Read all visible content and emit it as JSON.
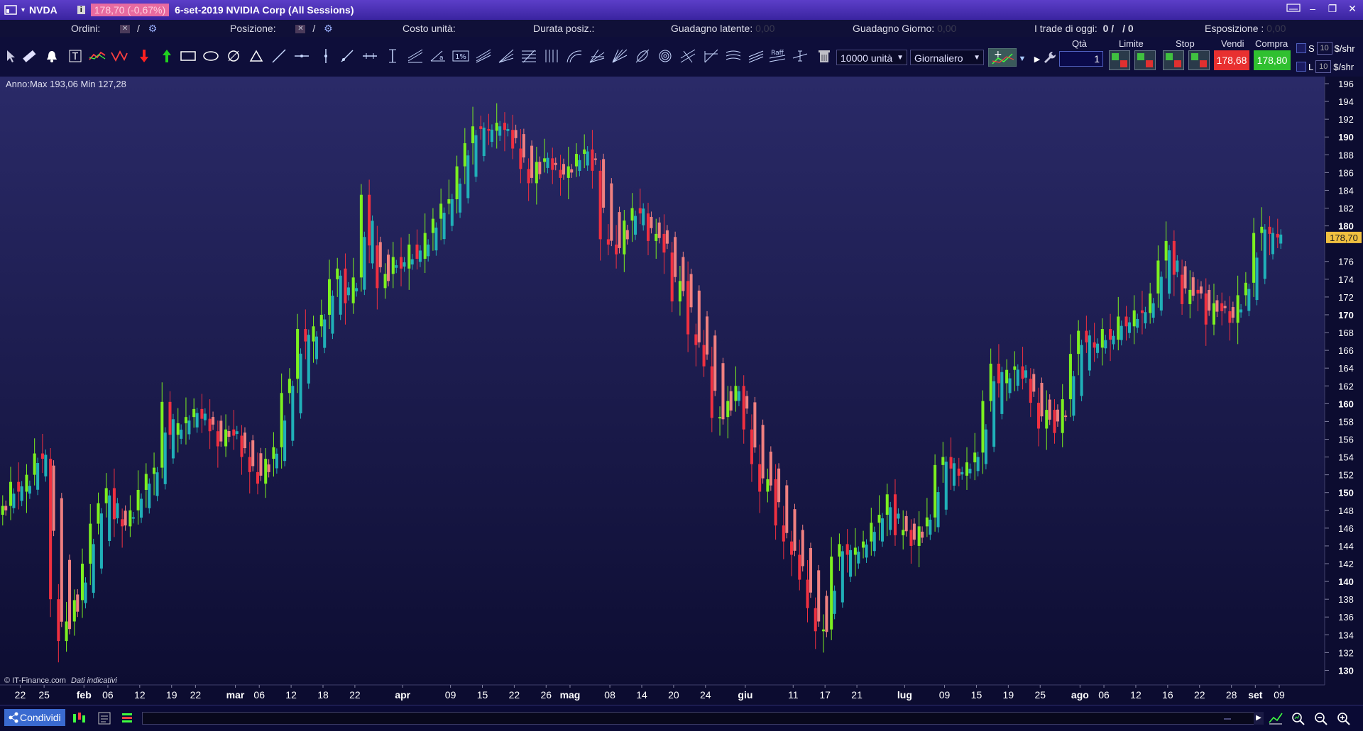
{
  "app": {
    "symbol": "NVDA",
    "info_badge": "i",
    "price_box": "178,70 (-0,67%)",
    "title": "6-set-2019 NVIDIA Corp (All Sessions)"
  },
  "status": {
    "orders_label": "Ordini:",
    "orders_sep": "/",
    "position_label": "Posizione:",
    "position_sep": "/",
    "unit_cost_label": "Costo unità:",
    "duration_label": "Durata posiz.:",
    "unrealized_label": "Guadagno latente:",
    "unrealized_value": "0,00",
    "day_gain_label": "Guadagno Giorno:",
    "day_gain_value": "0,00",
    "trades_label": "I trade di oggi:",
    "trades_value": "0 /",
    "trades_value2": "/ 0",
    "exposure_label": "Esposizione :",
    "exposure_value": "0,00"
  },
  "toolbar": {
    "quantity_select": "10000 unità",
    "period_select": "Giornaliero",
    "raff_label": "Raff",
    "order_labels": {
      "qty": "Qtà",
      "limit": "Limite",
      "stop": "Stop",
      "sell": "Vendi",
      "buy": "Compra"
    },
    "qty_value": "1",
    "sell_price": "178,68",
    "buy_price": "178,80",
    "s_label": "S",
    "l_label": "L",
    "s_num": "10",
    "l_num": "10",
    "per_share": "$/shr"
  },
  "chart_header": "Anno:Max 193,06 Min 127,28",
  "watermark_brand": "© IT-Finance.com",
  "watermark_note": "Dati indicativi",
  "bottom": {
    "share_label": "Condividi"
  },
  "colors": {
    "bg_top": "#2a2a6a",
    "bg_bottom": "#0c0c30",
    "up": "#7cf020",
    "down": "#f03040",
    "trend_up": "#20b0b8",
    "trend_down": "#f08080",
    "price_tag": "#f0c040"
  },
  "chart_data": {
    "type": "candlestick",
    "series_name": "NVDA",
    "ylim": [
      129,
      196
    ],
    "last_price": "178,70",
    "y_ticks": [
      {
        "v": 196,
        "label": "196",
        "bold": false
      },
      {
        "v": 194,
        "label": "194",
        "bold": false
      },
      {
        "v": 192,
        "label": "192",
        "bold": false
      },
      {
        "v": 190,
        "label": "190",
        "bold": true
      },
      {
        "v": 188,
        "label": "188",
        "bold": false
      },
      {
        "v": 186,
        "label": "186",
        "bold": false
      },
      {
        "v": 184,
        "label": "184",
        "bold": false
      },
      {
        "v": 182,
        "label": "182",
        "bold": false
      },
      {
        "v": 180,
        "label": "180",
        "bold": true
      },
      {
        "v": 176,
        "label": "176",
        "bold": false
      },
      {
        "v": 174,
        "label": "174",
        "bold": false
      },
      {
        "v": 172,
        "label": "172",
        "bold": false
      },
      {
        "v": 170,
        "label": "170",
        "bold": true
      },
      {
        "v": 168,
        "label": "168",
        "bold": false
      },
      {
        "v": 166,
        "label": "166",
        "bold": false
      },
      {
        "v": 164,
        "label": "164",
        "bold": false
      },
      {
        "v": 162,
        "label": "162",
        "bold": false
      },
      {
        "v": 160,
        "label": "160",
        "bold": true
      },
      {
        "v": 158,
        "label": "158",
        "bold": false
      },
      {
        "v": 156,
        "label": "156",
        "bold": false
      },
      {
        "v": 154,
        "label": "154",
        "bold": false
      },
      {
        "v": 152,
        "label": "152",
        "bold": false
      },
      {
        "v": 150,
        "label": "150",
        "bold": true
      },
      {
        "v": 148,
        "label": "148",
        "bold": false
      },
      {
        "v": 146,
        "label": "146",
        "bold": false
      },
      {
        "v": 144,
        "label": "144",
        "bold": false
      },
      {
        "v": 142,
        "label": "142",
        "bold": false
      },
      {
        "v": 140,
        "label": "140",
        "bold": true
      },
      {
        "v": 138,
        "label": "138",
        "bold": false
      },
      {
        "v": 136,
        "label": "136",
        "bold": false
      },
      {
        "v": 134,
        "label": "134",
        "bold": false
      },
      {
        "v": 132,
        "label": "132",
        "bold": false
      },
      {
        "v": 130,
        "label": "130",
        "bold": true
      }
    ],
    "x_ticks": [
      {
        "label": "22",
        "bold": false,
        "x": "2019-01-22"
      },
      {
        "label": "25",
        "bold": false,
        "x": "2019-01-25"
      },
      {
        "label": "feb",
        "bold": true,
        "x": "2019-02-01"
      },
      {
        "label": "06",
        "bold": false,
        "x": "2019-02-06"
      },
      {
        "label": "12",
        "bold": false,
        "x": "2019-02-12"
      },
      {
        "label": "19",
        "bold": false,
        "x": "2019-02-19"
      },
      {
        "label": "22",
        "bold": false,
        "x": "2019-02-22"
      },
      {
        "label": "mar",
        "bold": true,
        "x": "2019-03-01"
      },
      {
        "label": "06",
        "bold": false,
        "x": "2019-03-06"
      },
      {
        "label": "12",
        "bold": false,
        "x": "2019-03-12"
      },
      {
        "label": "18",
        "bold": false,
        "x": "2019-03-18"
      },
      {
        "label": "22",
        "bold": false,
        "x": "2019-03-22"
      },
      {
        "label": "apr",
        "bold": true,
        "x": "2019-04-01"
      },
      {
        "label": "09",
        "bold": false,
        "x": "2019-04-09"
      },
      {
        "label": "15",
        "bold": false,
        "x": "2019-04-15"
      },
      {
        "label": "22",
        "bold": false,
        "x": "2019-04-22"
      },
      {
        "label": "26",
        "bold": false,
        "x": "2019-04-26"
      },
      {
        "label": "mag",
        "bold": true,
        "x": "2019-05-01"
      },
      {
        "label": "08",
        "bold": false,
        "x": "2019-05-08"
      },
      {
        "label": "14",
        "bold": false,
        "x": "2019-05-14"
      },
      {
        "label": "20",
        "bold": false,
        "x": "2019-05-20"
      },
      {
        "label": "24",
        "bold": false,
        "x": "2019-05-24"
      },
      {
        "label": "giu",
        "bold": true,
        "x": "2019-06-03"
      },
      {
        "label": "11",
        "bold": false,
        "x": "2019-06-11"
      },
      {
        "label": "17",
        "bold": false,
        "x": "2019-06-17"
      },
      {
        "label": "21",
        "bold": false,
        "x": "2019-06-21"
      },
      {
        "label": "lug",
        "bold": true,
        "x": "2019-07-01"
      },
      {
        "label": "09",
        "bold": false,
        "x": "2019-07-09"
      },
      {
        "label": "15",
        "bold": false,
        "x": "2019-07-15"
      },
      {
        "label": "19",
        "bold": false,
        "x": "2019-07-19"
      },
      {
        "label": "25",
        "bold": false,
        "x": "2019-07-25"
      },
      {
        "label": "ago",
        "bold": true,
        "x": "2019-08-01"
      },
      {
        "label": "06",
        "bold": false,
        "x": "2019-08-06"
      },
      {
        "label": "12",
        "bold": false,
        "x": "2019-08-12"
      },
      {
        "label": "16",
        "bold": false,
        "x": "2019-08-16"
      },
      {
        "label": "22",
        "bold": false,
        "x": "2019-08-22"
      },
      {
        "label": "28",
        "bold": false,
        "x": "2019-08-28"
      },
      {
        "label": "set",
        "bold": true,
        "x": "2019-09-03"
      },
      {
        "label": "09",
        "bold": false,
        "x": "2019-09-09"
      }
    ],
    "candles": [
      {
        "x": "2019-01-18",
        "c": 148.5
      },
      {
        "x": "2019-01-21",
        "c": 151.2
      },
      {
        "x": "2019-01-22",
        "c": 150.1
      },
      {
        "x": "2019-01-23",
        "c": 152.0
      },
      {
        "x": "2019-01-24",
        "c": 154.4
      },
      {
        "x": "2019-01-25",
        "c": 153.8
      },
      {
        "x": "2019-01-28",
        "c": 138.0
      },
      {
        "x": "2019-01-29",
        "c": 133.3
      },
      {
        "x": "2019-01-30",
        "c": 135.5
      },
      {
        "x": "2019-01-31",
        "c": 137.9
      },
      {
        "x": "2019-02-01",
        "c": 142.0
      },
      {
        "x": "2019-02-04",
        "c": 146.5
      },
      {
        "x": "2019-02-05",
        "c": 148.8
      },
      {
        "x": "2019-02-06",
        "c": 150.5
      },
      {
        "x": "2019-02-07",
        "c": 147.0
      },
      {
        "x": "2019-02-08",
        "c": 146.2
      },
      {
        "x": "2019-02-11",
        "c": 148.0
      },
      {
        "x": "2019-02-12",
        "c": 150.3
      },
      {
        "x": "2019-02-13",
        "c": 152.1
      },
      {
        "x": "2019-02-14",
        "c": 152.8
      },
      {
        "x": "2019-02-15",
        "c": 160.2
      },
      {
        "x": "2019-02-19",
        "c": 156.5
      },
      {
        "x": "2019-02-20",
        "c": 157.8
      },
      {
        "x": "2019-02-21",
        "c": 158.5
      },
      {
        "x": "2019-02-22",
        "c": 159.4
      },
      {
        "x": "2019-02-25",
        "c": 158.3
      },
      {
        "x": "2019-02-26",
        "c": 156.9
      },
      {
        "x": "2019-02-27",
        "c": 155.2
      },
      {
        "x": "2019-02-28",
        "c": 157.1
      },
      {
        "x": "2019-03-01",
        "c": 156.4
      },
      {
        "x": "2019-03-04",
        "c": 154.0
      },
      {
        "x": "2019-03-05",
        "c": 152.3
      },
      {
        "x": "2019-03-06",
        "c": 151.0
      },
      {
        "x": "2019-03-07",
        "c": 153.8
      },
      {
        "x": "2019-03-08",
        "c": 155.1
      },
      {
        "x": "2019-03-11",
        "c": 161.2
      },
      {
        "x": "2019-03-12",
        "c": 162.8
      },
      {
        "x": "2019-03-13",
        "c": 168.4
      },
      {
        "x": "2019-03-14",
        "c": 167.0
      },
      {
        "x": "2019-03-15",
        "c": 168.7
      },
      {
        "x": "2019-03-18",
        "c": 170.0
      },
      {
        "x": "2019-03-19",
        "c": 174.0
      },
      {
        "x": "2019-03-20",
        "c": 175.2
      },
      {
        "x": "2019-03-21",
        "c": 171.3
      },
      {
        "x": "2019-03-22",
        "c": 174.2
      },
      {
        "x": "2019-03-25",
        "c": 183.5
      },
      {
        "x": "2019-03-26",
        "c": 177.8
      },
      {
        "x": "2019-03-27",
        "c": 173.0
      },
      {
        "x": "2019-03-28",
        "c": 174.6
      },
      {
        "x": "2019-03-29",
        "c": 176.5
      },
      {
        "x": "2019-04-01",
        "c": 175.2
      },
      {
        "x": "2019-04-02",
        "c": 177.9
      },
      {
        "x": "2019-04-03",
        "c": 176.3
      },
      {
        "x": "2019-04-04",
        "c": 179.2
      },
      {
        "x": "2019-04-05",
        "c": 180.8
      },
      {
        "x": "2019-04-08",
        "c": 182.5
      },
      {
        "x": "2019-04-09",
        "c": 183.0
      },
      {
        "x": "2019-04-10",
        "c": 186.7
      },
      {
        "x": "2019-04-11",
        "c": 189.3
      },
      {
        "x": "2019-04-12",
        "c": 191.2
      },
      {
        "x": "2019-04-15",
        "c": 190.9
      },
      {
        "x": "2019-04-16",
        "c": 190.7
      },
      {
        "x": "2019-04-17",
        "c": 191.6
      },
      {
        "x": "2019-04-18",
        "c": 190.8
      },
      {
        "x": "2019-04-22",
        "c": 188.7
      },
      {
        "x": "2019-04-23",
        "c": 186.4
      },
      {
        "x": "2019-04-24",
        "c": 184.8
      },
      {
        "x": "2019-04-25",
        "c": 187.2
      },
      {
        "x": "2019-04-26",
        "c": 187.6
      },
      {
        "x": "2019-04-29",
        "c": 186.3
      },
      {
        "x": "2019-04-30",
        "c": 185.4
      },
      {
        "x": "2019-05-01",
        "c": 186.7
      },
      {
        "x": "2019-05-02",
        "c": 188.1
      },
      {
        "x": "2019-05-03",
        "c": 188.6
      },
      {
        "x": "2019-05-06",
        "c": 186.2
      },
      {
        "x": "2019-05-07",
        "c": 178.5
      },
      {
        "x": "2019-05-08",
        "c": 177.9
      },
      {
        "x": "2019-05-09",
        "c": 176.8
      },
      {
        "x": "2019-05-10",
        "c": 180.6
      },
      {
        "x": "2019-05-13",
        "c": 182.0
      },
      {
        "x": "2019-05-14",
        "c": 181.4
      },
      {
        "x": "2019-05-15",
        "c": 178.3
      },
      {
        "x": "2019-05-16",
        "c": 179.1
      },
      {
        "x": "2019-05-17",
        "c": 177.0
      },
      {
        "x": "2019-05-20",
        "c": 171.5
      },
      {
        "x": "2019-05-21",
        "c": 173.8
      },
      {
        "x": "2019-05-22",
        "c": 167.8
      },
      {
        "x": "2019-05-23",
        "c": 166.6
      },
      {
        "x": "2019-05-24",
        "c": 164.2
      },
      {
        "x": "2019-05-28",
        "c": 158.4
      },
      {
        "x": "2019-05-29",
        "c": 158.5
      },
      {
        "x": "2019-05-30",
        "c": 160.3
      },
      {
        "x": "2019-05-31",
        "c": 162.0
      },
      {
        "x": "2019-06-03",
        "c": 157.1
      },
      {
        "x": "2019-06-04",
        "c": 153.2
      },
      {
        "x": "2019-06-05",
        "c": 150.1
      },
      {
        "x": "2019-06-06",
        "c": 151.5
      },
      {
        "x": "2019-06-07",
        "c": 146.3
      },
      {
        "x": "2019-06-10",
        "c": 144.5
      },
      {
        "x": "2019-06-11",
        "c": 143.0
      },
      {
        "x": "2019-06-12",
        "c": 140.2
      },
      {
        "x": "2019-06-13",
        "c": 137.0
      },
      {
        "x": "2019-06-14",
        "c": 134.4
      },
      {
        "x": "2019-06-17",
        "c": 134.6
      },
      {
        "x": "2019-06-18",
        "c": 142.8
      },
      {
        "x": "2019-06-19",
        "c": 144.2
      },
      {
        "x": "2019-06-20",
        "c": 143.0
      },
      {
        "x": "2019-06-21",
        "c": 143.8
      },
      {
        "x": "2019-06-24",
        "c": 144.5
      },
      {
        "x": "2019-06-25",
        "c": 146.6
      },
      {
        "x": "2019-06-26",
        "c": 147.5
      },
      {
        "x": "2019-06-27",
        "c": 149.8
      },
      {
        "x": "2019-06-28",
        "c": 145.2
      },
      {
        "x": "2019-07-01",
        "c": 145.8
      },
      {
        "x": "2019-07-02",
        "c": 144.0
      },
      {
        "x": "2019-07-03",
        "c": 146.2
      },
      {
        "x": "2019-07-05",
        "c": 147.2
      },
      {
        "x": "2019-07-08",
        "c": 153.1
      },
      {
        "x": "2019-07-09",
        "c": 154.0
      },
      {
        "x": "2019-07-10",
        "c": 152.7
      },
      {
        "x": "2019-07-11",
        "c": 151.9
      },
      {
        "x": "2019-07-12",
        "c": 153.4
      },
      {
        "x": "2019-07-15",
        "c": 154.5
      },
      {
        "x": "2019-07-16",
        "c": 160.3
      },
      {
        "x": "2019-07-17",
        "c": 164.5
      },
      {
        "x": "2019-07-18",
        "c": 162.3
      },
      {
        "x": "2019-07-19",
        "c": 163.8
      },
      {
        "x": "2019-07-22",
        "c": 164.2
      },
      {
        "x": "2019-07-23",
        "c": 162.8
      },
      {
        "x": "2019-07-24",
        "c": 160.1
      },
      {
        "x": "2019-07-25",
        "c": 157.2
      },
      {
        "x": "2019-07-26",
        "c": 159.3
      },
      {
        "x": "2019-07-29",
        "c": 156.7
      },
      {
        "x": "2019-07-30",
        "c": 160.5
      },
      {
        "x": "2019-07-31",
        "c": 165.6
      },
      {
        "x": "2019-08-01",
        "c": 168.2
      },
      {
        "x": "2019-08-02",
        "c": 166.9
      },
      {
        "x": "2019-08-05",
        "c": 166.3
      },
      {
        "x": "2019-08-06",
        "c": 168.4
      },
      {
        "x": "2019-08-07",
        "c": 167.2
      },
      {
        "x": "2019-08-08",
        "c": 169.8
      },
      {
        "x": "2019-08-09",
        "c": 168.7
      },
      {
        "x": "2019-08-12",
        "c": 170.5
      },
      {
        "x": "2019-08-13",
        "c": 170.2
      },
      {
        "x": "2019-08-14",
        "c": 172.4
      },
      {
        "x": "2019-08-15",
        "c": 176.1
      },
      {
        "x": "2019-08-16",
        "c": 178.3
      },
      {
        "x": "2019-08-19",
        "c": 174.5
      },
      {
        "x": "2019-08-20",
        "c": 171.2
      },
      {
        "x": "2019-08-21",
        "c": 172.8
      },
      {
        "x": "2019-08-22",
        "c": 172.4
      },
      {
        "x": "2019-08-23",
        "c": 168.9
      },
      {
        "x": "2019-08-26",
        "c": 171.3
      },
      {
        "x": "2019-08-27",
        "c": 170.4
      },
      {
        "x": "2019-08-28",
        "c": 169.1
      },
      {
        "x": "2019-08-29",
        "c": 172.2
      },
      {
        "x": "2019-08-30",
        "c": 173.6
      },
      {
        "x": "2019-09-03",
        "c": 179.2
      },
      {
        "x": "2019-09-04",
        "c": 179.9
      },
      {
        "x": "2019-09-05",
        "c": 179.1
      },
      {
        "x": "2019-09-06",
        "c": 178.7
      }
    ]
  }
}
